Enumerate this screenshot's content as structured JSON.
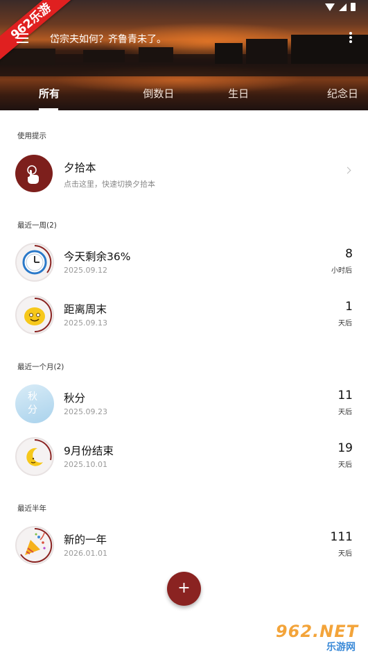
{
  "watermark": {
    "banner": "962乐游"
  },
  "toolbar": {
    "title": "岱宗夫如何？齐鲁青未了。"
  },
  "tabs": [
    "所有",
    "倒数日",
    "生日",
    "纪念日"
  ],
  "sections": {
    "tips": "使用提示",
    "week": "最近一周(2)",
    "month": "最近一个月(2)",
    "half_year": "最近半年"
  },
  "tip": {
    "title": "夕拾本",
    "subtitle": "点击这里，快速切换夕拾本"
  },
  "events": [
    {
      "title": "今天剩余36%",
      "date": "2025.09.12",
      "count": "8",
      "unit": "小时后",
      "icon": "clock-icon",
      "progress": 0.36
    },
    {
      "title": "距离周末",
      "date": "2025.09.13",
      "count": "1",
      "unit": "天后",
      "icon": "smiley-icon",
      "progress": 0.5
    },
    {
      "title": "秋分",
      "date": "2025.09.23",
      "count": "11",
      "unit": "天后",
      "icon": "autumn-image",
      "avatar_text": "秋 分",
      "progress": 0
    },
    {
      "title": "9月份结束",
      "date": "2025.10.01",
      "count": "19",
      "unit": "天后",
      "icon": "moon-icon",
      "progress": 0.4
    },
    {
      "title": "新的一年",
      "date": "2026.01.01",
      "count": "111",
      "unit": "天后",
      "icon": "party-popper-icon",
      "progress": 0.62
    }
  ],
  "fab": {
    "label": "+"
  },
  "corner_logo": {
    "main": "962.NET",
    "sub": "乐游网"
  },
  "colors": {
    "accent": "#8a2321",
    "tip_avatar": "#7d1f1c"
  }
}
